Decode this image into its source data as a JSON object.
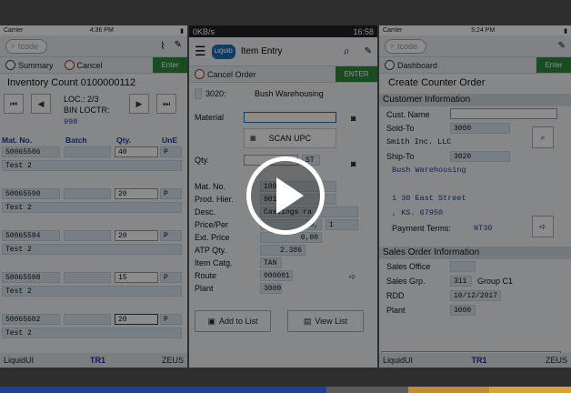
{
  "left": {
    "status": {
      "carrier": "Carrier",
      "time": "4:36 PM"
    },
    "search_placeholder": "tcode",
    "buttons": {
      "summary": "Summary",
      "cancel": "Cancel",
      "enter": "Enter"
    },
    "title": "Inventory Count 0100000112",
    "loc": "LOC.: 2/3",
    "bin_label": "BIN LOCTR:",
    "bin_value": "998",
    "columns": [
      "Mat. No.",
      "Batch",
      "Qty.",
      "UnE"
    ],
    "rows": [
      {
        "mat": "50065586",
        "qty": "40",
        "une": "P",
        "desc": "Test 2"
      },
      {
        "mat": "50065590",
        "qty": "20",
        "une": "P",
        "desc": "Test 2"
      },
      {
        "mat": "50065594",
        "qty": "20",
        "une": "P",
        "desc": "Test 2"
      },
      {
        "mat": "50065598",
        "qty": "15",
        "une": "P",
        "desc": "Test 2"
      },
      {
        "mat": "50065602",
        "qty": "20",
        "une": "P",
        "desc": "Test 2"
      }
    ],
    "footer": {
      "brand": "LiquidUI",
      "tr": "TR1",
      "sys": "ZEUS"
    }
  },
  "middle": {
    "status": {
      "data": "0KB/s",
      "time": "16:58"
    },
    "app_title": "Item Entry",
    "logo": "LIQUID",
    "cancel_order": "Cancel Order",
    "enter": "ENTER",
    "plant_code": "3020:",
    "plant_name": "Bush Warehousing",
    "material_label": "Material",
    "scan_upc": "SCAN UPC",
    "qty_label": "Qty.",
    "qty_unit": "ST",
    "fields": [
      {
        "label": "Mat. No.",
        "value": "100"
      },
      {
        "label": "Prod. Hier.",
        "value": "001"
      },
      {
        "label": "Desc.",
        "value": "Castings ra"
      },
      {
        "label": "Price/Per",
        "value": "0,",
        "extra": "1"
      },
      {
        "label": "Ext. Price",
        "value": "0,00"
      },
      {
        "label": "ATP Qty.",
        "value": "2.386"
      },
      {
        "label": "Item Catg.",
        "value": "TAN"
      },
      {
        "label": "Route",
        "value": "000001"
      },
      {
        "label": "Plant",
        "value": "3000"
      }
    ],
    "add_to_list": "Add to List",
    "view_list": "View List"
  },
  "right": {
    "status": {
      "carrier": "Carrier",
      "time": "5:24 PM"
    },
    "search_placeholder": "tcode",
    "dashboard": "Dashboard",
    "enter": "Enter",
    "title": "Create Counter Order",
    "customer_section": "Customer Information",
    "cust_name_label": "Cust. Name",
    "sold_to_label": "Sold-To",
    "sold_to_value": "3000",
    "sold_to_name": "Smith Inc. LLC",
    "ship_to_label": "Ship-To",
    "ship_to_value": "3020",
    "ship_to_name": "Bush Warehousing",
    "address1": "1 30 East Street",
    "address2": ", KS. 67950",
    "payment_label": "Payment Terms:",
    "payment_value": "NT30",
    "sales_section": "Sales Order Information",
    "sales_office_label": "Sales Office",
    "sales_grp_label": "Sales Grp.",
    "sales_grp_code": "311",
    "sales_grp_name": "Group C1",
    "rdd_label": "RDD",
    "rdd_value": "10/12/2017",
    "plant_label": "Plant",
    "plant_value": "3000",
    "footer": {
      "brand": "LiquidUI",
      "tr": "TR1",
      "sys": "ZEUS"
    }
  },
  "colors": {
    "enter_green": "#2e8b3a",
    "header_blue": "#1a3d9c",
    "tr_blue": "#1b28c9"
  }
}
